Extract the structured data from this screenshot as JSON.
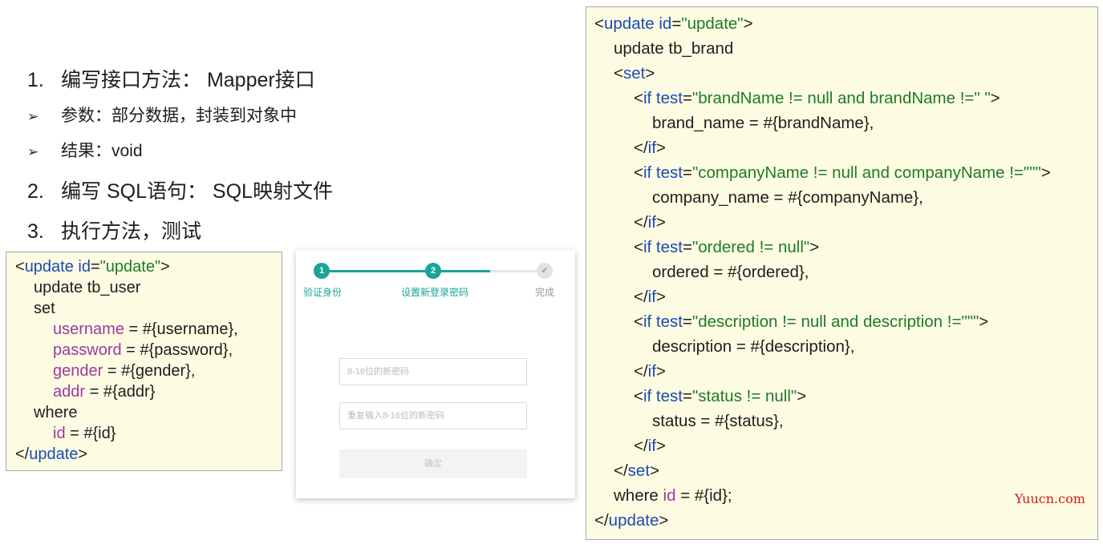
{
  "steps": [
    {
      "num": "1.",
      "text": "编写接口方法： Mapper接口"
    },
    {
      "num": "2.",
      "text": "编写 SQL语句： SQL映射文件"
    },
    {
      "num": "3.",
      "text": "执行方法，测试"
    }
  ],
  "bullets": [
    {
      "glyph": "➢",
      "text": "参数：部分数据，封装到对象中"
    },
    {
      "glyph": "➢",
      "text": "结果：void"
    }
  ],
  "small_code": {
    "l1": {
      "p1": "<",
      "p2": "update id",
      "p3": "=",
      "p4": "\"update\"",
      "p5": ">"
    },
    "l2": "update tb_user",
    "l3": "set",
    "l4": {
      "attr": "username",
      "rest": " = #{username},"
    },
    "l5": {
      "attr": "password",
      "rest": " = #{password},"
    },
    "l6": {
      "attr": "gender",
      "rest": " = #{gender},"
    },
    "l7": {
      "attr": "addr",
      "rest": " = #{addr}"
    },
    "l8": "where",
    "l9": {
      "attr": "id",
      "rest": " = #{id}"
    },
    "l10": {
      "p1": "</",
      "p2": "update",
      "p3": ">"
    }
  },
  "reset_card": {
    "steps": [
      {
        "num": "1",
        "label": "验证身份"
      },
      {
        "num": "2",
        "label": "设置新登录密码"
      },
      {
        "num": "✔",
        "label": "完成"
      }
    ],
    "new_password_placeholder": "8-16位的新密码",
    "repeat_password_placeholder": "重复输入8-16位的新密码",
    "confirm_label": "确定",
    "accent_color": "#1aa39a"
  },
  "big_code": {
    "l1": {
      "p1": "<",
      "p2": "update id",
      "p3": "=",
      "p4": "\"update\"",
      "p5": ">"
    },
    "l2": "update tb_brand",
    "l3": {
      "p1": "<",
      "p2": "set",
      "p3": ">"
    },
    "l4": {
      "p1": "<",
      "p2": "if test",
      "p3": "=",
      "p4": "\"brandName != null and brandName !=\" \"",
      "p5": ">"
    },
    "l5": "brand_name = #{brandName},",
    "l6": {
      "p1": "</",
      "p2": "if",
      "p3": ">"
    },
    "l7": {
      "p1": "<",
      "p2": "if test",
      "p3": "=",
      "p4": "\"companyName != null and companyName !=\"\"\"",
      "p5": ">"
    },
    "l8": "company_name = #{companyName},",
    "l9": {
      "p1": "</",
      "p2": "if",
      "p3": ">"
    },
    "l10": {
      "p1": "<",
      "p2": "if test",
      "p3": "=",
      "p4": "\"ordered != null\"",
      "p5": ">"
    },
    "l11": "ordered = #{ordered},",
    "l12": {
      "p1": "</",
      "p2": "if",
      "p3": ">"
    },
    "l13": {
      "p1": "<",
      "p2": "if test",
      "p3": "=",
      "p4": "\"description != null and description !=\"\"\"",
      "p5": ">"
    },
    "l14": "description = #{description},",
    "l15": {
      "p1": "</",
      "p2": "if",
      "p3": ">"
    },
    "l16": {
      "p1": "<",
      "p2": "if test",
      "p3": "=",
      "p4": "\"status != null\"",
      "p5": ">"
    },
    "l17": "status = #{status},",
    "l18": {
      "p1": "</",
      "p2": "if",
      "p3": ">"
    },
    "l19": {
      "p1": "</",
      "p2": "set",
      "p3": ">"
    },
    "l20": {
      "p1": "where ",
      "p2": "id",
      "p3": " = #{id};"
    },
    "l21": {
      "p1": "</",
      "p2": "update",
      "p3": ">"
    }
  },
  "watermark": "Yuucn.com"
}
